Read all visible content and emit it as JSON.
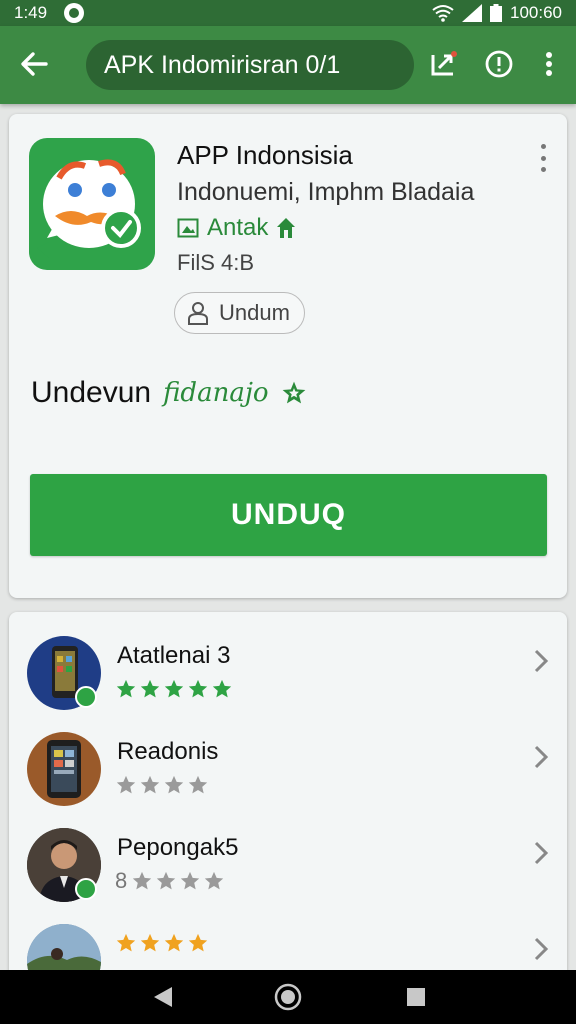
{
  "status": {
    "time": "1:49",
    "battery": "100:60"
  },
  "app_bar": {
    "query": "APK Indomirisran 0/1"
  },
  "app": {
    "title": "APP Indonsisia",
    "developer": "Indonuemi, Imphm Bladaia",
    "category": "Antak",
    "size": "FilS 4:B",
    "chip_label": "Undum",
    "rating_label": "Undevun",
    "rating_sub": "fidanajo",
    "install_label": "UNDUQ"
  },
  "list": [
    {
      "name": "Atatlenai 3",
      "stars": 5,
      "prefix": "",
      "star_color": "green"
    },
    {
      "name": "Readonis",
      "stars": 4,
      "prefix": "",
      "star_color": "gray"
    },
    {
      "name": "Pepongak5",
      "stars": 4,
      "prefix": "8",
      "star_color": "gray"
    },
    {
      "name": "",
      "stars": 4,
      "prefix": "",
      "star_color": "orange"
    }
  ],
  "colors": {
    "status_bar": "#2f6d36",
    "app_bar": "#3d8a44",
    "accent": "#2ea344",
    "star_gray": "#9a9a9a",
    "star_orange": "#f0a21f"
  },
  "icons": {
    "back": "arrow-left-icon",
    "share": "share-icon",
    "info": "info-icon",
    "menu": "more-vert-icon",
    "category": "image-icon",
    "chip": "person-icon",
    "nav_back": "triangle-back-icon",
    "nav_home": "circle-home-icon",
    "nav_recent": "square-recent-icon"
  }
}
